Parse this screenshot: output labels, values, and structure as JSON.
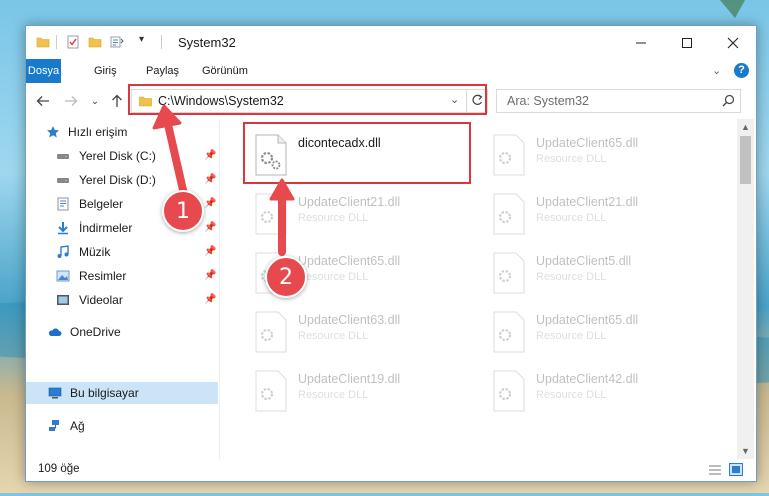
{
  "window": {
    "title": "System32"
  },
  "ribbon": {
    "tabs": [
      {
        "label": "Dosya"
      },
      {
        "label": "Giriş"
      },
      {
        "label": "Paylaş"
      },
      {
        "label": "Görünüm"
      }
    ]
  },
  "navigation": {
    "address": "C:\\Windows\\System32",
    "search_placeholder": "Ara: System32"
  },
  "sidebar": {
    "items": [
      {
        "label": "Hızlı erişim",
        "icon": "star-icon"
      },
      {
        "label": "Yerel Disk (C:)",
        "icon": "drive-icon",
        "pinned": true
      },
      {
        "label": "Yerel Disk (D:)",
        "icon": "drive-icon",
        "pinned": true
      },
      {
        "label": "Belgeler",
        "icon": "documents-icon",
        "pinned": true
      },
      {
        "label": "İndirmeler",
        "icon": "downloads-icon",
        "pinned": true
      },
      {
        "label": "Müzik",
        "icon": "music-icon",
        "pinned": true
      },
      {
        "label": "Resimler",
        "icon": "pictures-icon",
        "pinned": true
      },
      {
        "label": "Videolar",
        "icon": "videos-icon",
        "pinned": true
      },
      {
        "label": "OneDrive",
        "icon": "cloud-icon"
      },
      {
        "label": "Bu bilgisayar",
        "icon": "computer-icon",
        "selected": true
      },
      {
        "label": "Ağ",
        "icon": "network-icon"
      }
    ]
  },
  "files": [
    {
      "name": "dicontecadx.dll",
      "type": ""
    },
    {
      "name": "UpdateClient65.dll",
      "type": "Resource DLL"
    },
    {
      "name": "UpdateClient21.dll",
      "type": "Resource DLL"
    },
    {
      "name": "UpdateClient21.dll",
      "type": "Resource DLL"
    },
    {
      "name": "UpdateClient65.dll",
      "type": "Resource DLL"
    },
    {
      "name": "UpdateClient5.dll",
      "type": "Resource DLL"
    },
    {
      "name": "UpdateClient63.dll",
      "type": "Resource DLL"
    },
    {
      "name": "UpdateClient65.dll",
      "type": "Resource DLL"
    },
    {
      "name": "UpdateClient19.dll",
      "type": "Resource DLL"
    },
    {
      "name": "UpdateClient42.dll",
      "type": "Resource DLL"
    }
  ],
  "status": {
    "item_count": "109 öğe"
  },
  "annotations": {
    "step1": "1",
    "step2": "2"
  },
  "colors": {
    "accent": "#1979ca",
    "annotation": "#e64a4f",
    "selection": "#cce4f7"
  }
}
